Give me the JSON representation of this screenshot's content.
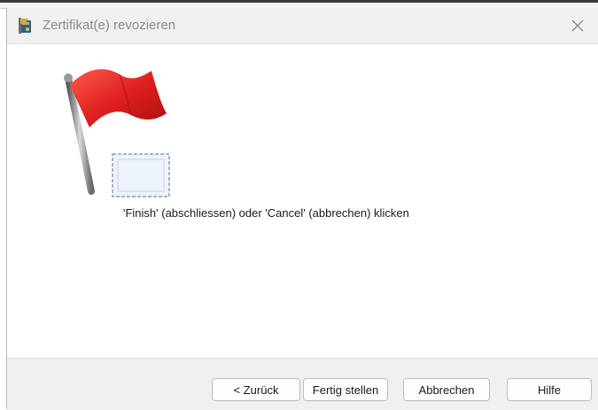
{
  "window": {
    "title": "Zertifikat(e) revozieren",
    "icons": {
      "app": "certificate-app-icon",
      "close": "close-icon",
      "illustration": "red-flag-certificate-icon"
    }
  },
  "content": {
    "message": "'Finish' (abschliessen) oder 'Cancel' (abbrechen) klicken"
  },
  "buttons": {
    "back": "< Zurück",
    "finish": "Fertig stellen",
    "cancel": "Abbrechen",
    "help": "Hilfe"
  },
  "colors": {
    "flag": "#e02020",
    "footer": "#f0f0f0",
    "titlebar": "#f0f0f0"
  }
}
